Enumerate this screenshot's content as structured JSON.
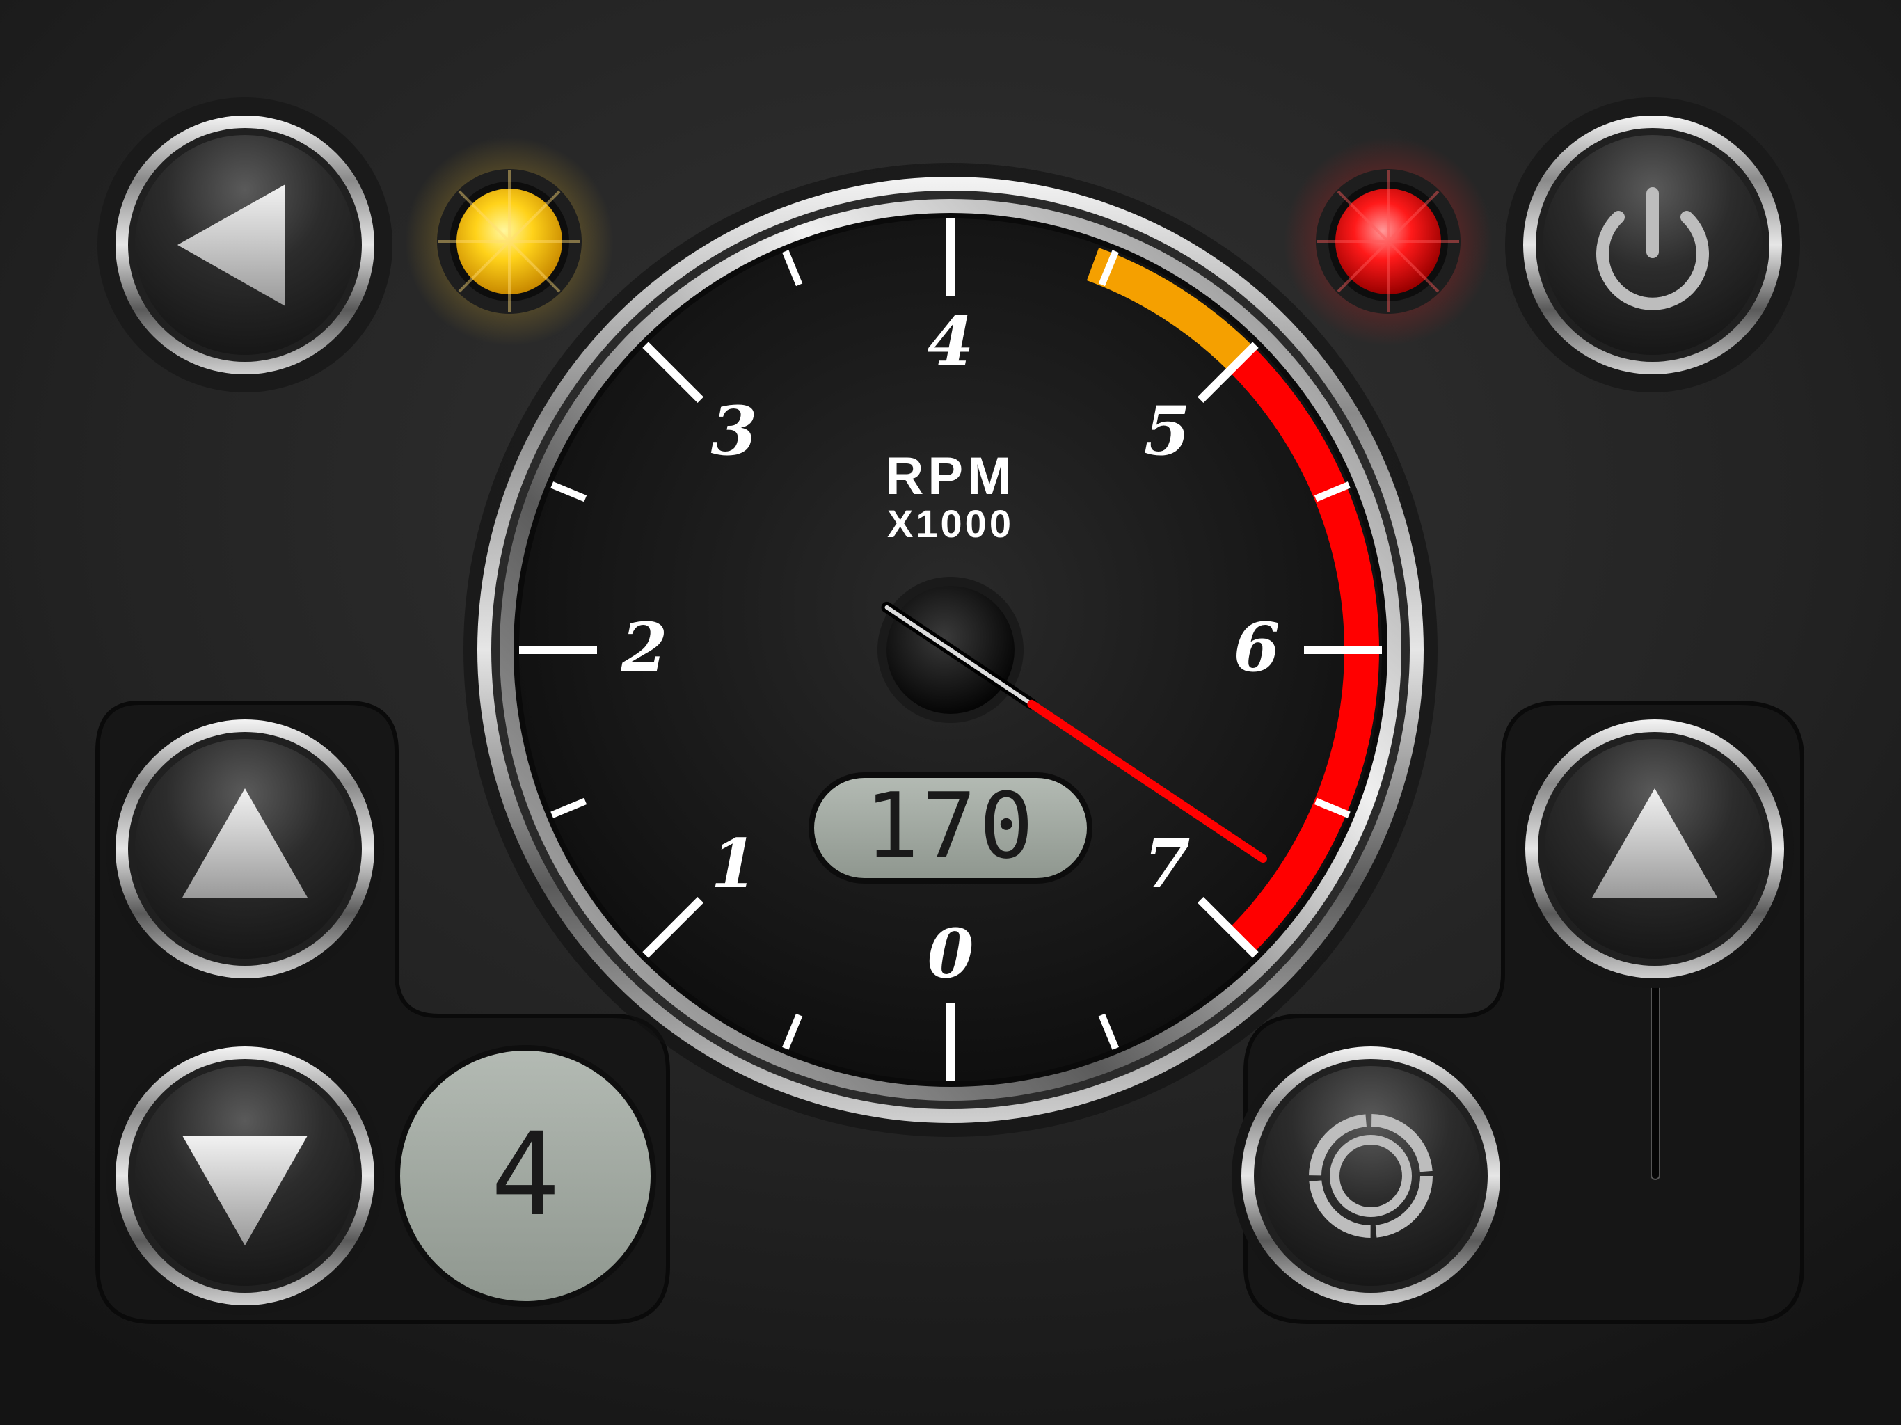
{
  "gauge": {
    "label": "RPM",
    "multiplier": "X1000",
    "scale": {
      "min": 0,
      "max": 7,
      "numbers": [
        "0",
        "1",
        "2",
        "3",
        "4",
        "5",
        "6",
        "7"
      ]
    },
    "caution_band_rpm_x1000": [
      4.45,
      5.0
    ],
    "redline_band_rpm_x1000": [
      5.0,
      7.0
    ],
    "needle_value_rpm_x1000": 6.75,
    "readout": "170"
  },
  "gear_display": {
    "value": "4"
  },
  "indicators": {
    "left_lamp_color": "#ffd21a",
    "right_lamp_color": "#ff1a1a"
  },
  "buttons": {
    "back": {
      "icon": "left-triangle-icon"
    },
    "power": {
      "icon": "power-icon"
    },
    "gear_up": {
      "icon": "up-triangle-icon"
    },
    "gear_down": {
      "icon": "down-triangle-icon"
    },
    "throttle_up": {
      "icon": "up-triangle-icon"
    },
    "reset": {
      "icon": "ring-icon"
    }
  },
  "colors": {
    "background": "#1d1d1d",
    "gauge_face": "#151515",
    "lcd": "#a3aba3",
    "lcd_text": "#1a1a1a",
    "caution": "#f5a000",
    "redline": "#ff0000",
    "needle": "#ff0000"
  }
}
